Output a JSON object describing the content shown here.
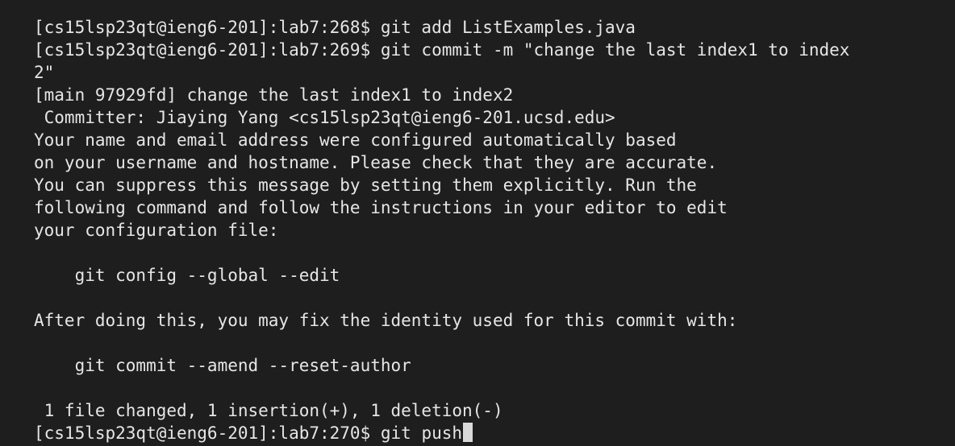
{
  "terminal": {
    "lines": [
      "[cs15lsp23qt@ieng6-201]:lab7:268$ git add ListExamples.java",
      "[cs15lsp23qt@ieng6-201]:lab7:269$ git commit -m \"change the last index1 to index",
      "2\"",
      "[main 97929fd] change the last index1 to index2",
      " Committer: Jiaying Yang <cs15lsp23qt@ieng6-201.ucsd.edu>",
      "Your name and email address were configured automatically based",
      "on your username and hostname. Please check that they are accurate.",
      "You can suppress this message by setting them explicitly. Run the",
      "following command and follow the instructions in your editor to edit",
      "your configuration file:",
      "",
      "    git config --global --edit",
      "",
      "After doing this, you may fix the identity used for this commit with:",
      "",
      "    git commit --amend --reset-author",
      "",
      " 1 file changed, 1 insertion(+), 1 deletion(-)"
    ],
    "prompt": "[cs15lsp23qt@ieng6-201]:lab7:270$ ",
    "current_command": "git push"
  },
  "colors": {
    "background": "#1e1e1e",
    "foreground": "#e6e6e6",
    "cursor": "#d9d9d9"
  }
}
